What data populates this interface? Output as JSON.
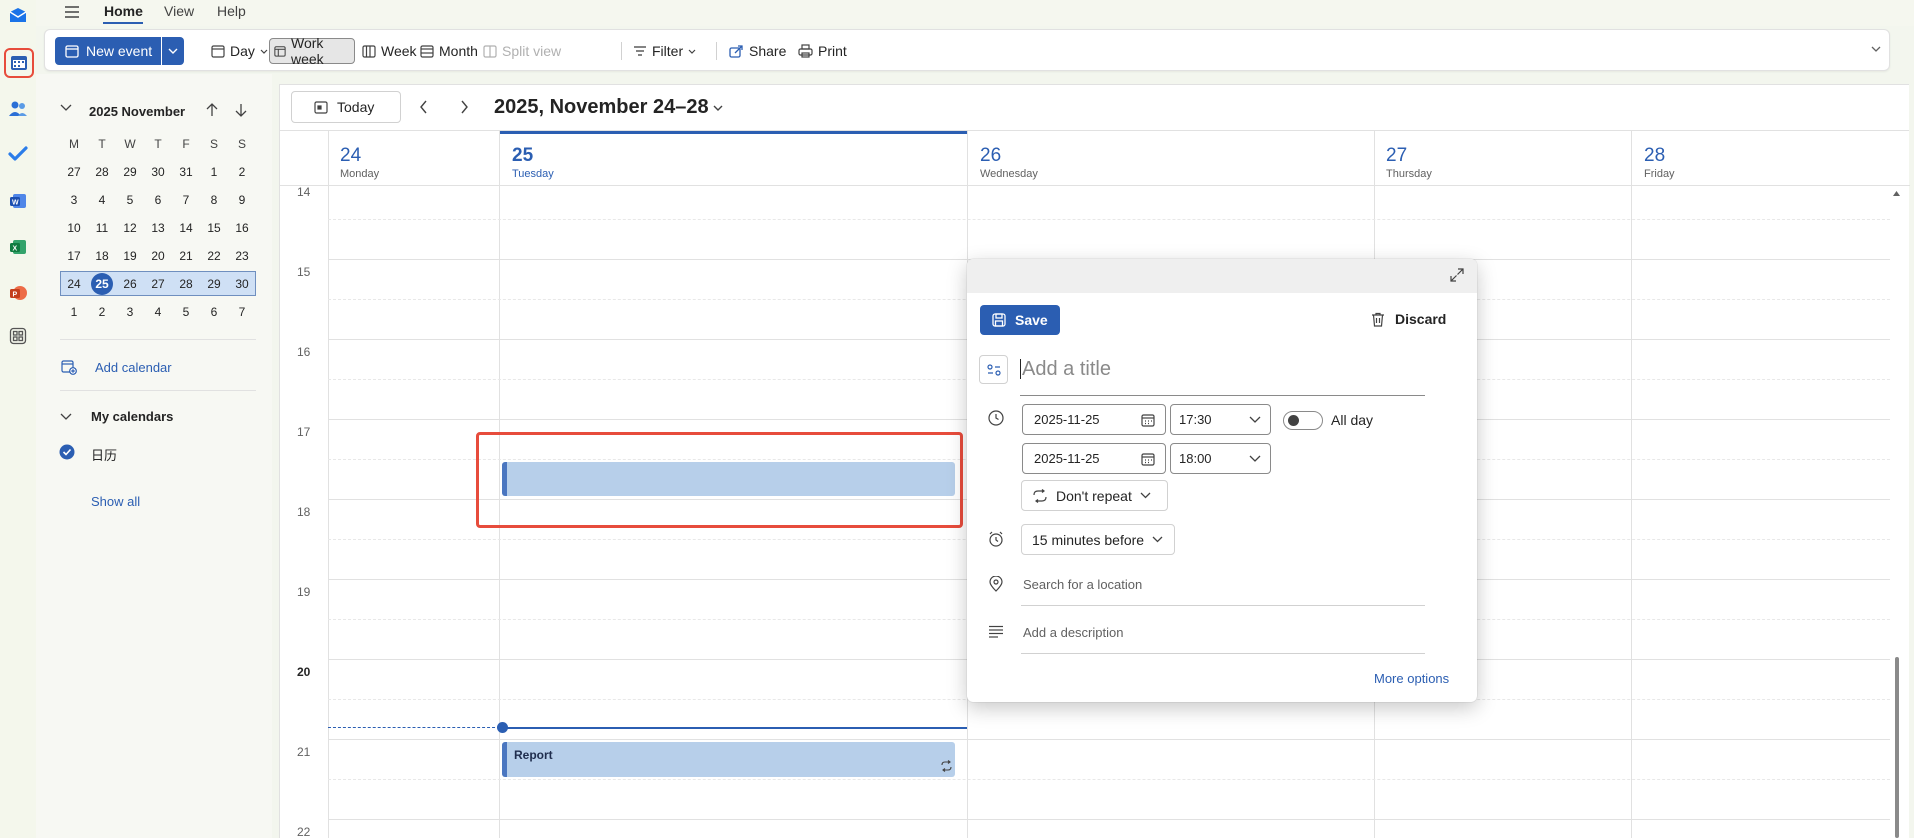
{
  "menubar": {
    "tabs": [
      "Home",
      "View",
      "Help"
    ]
  },
  "ribbon": {
    "new_event": "New event",
    "day": "Day",
    "work_week": "Work week",
    "week": "Week",
    "month": "Month",
    "split_view": "Split view",
    "filter": "Filter",
    "share": "Share",
    "print": "Print"
  },
  "mini_calendar": {
    "title": "2025 November",
    "weekday_headers": [
      "M",
      "T",
      "W",
      "T",
      "F",
      "S",
      "S"
    ],
    "weeks": [
      [
        "27",
        "28",
        "29",
        "30",
        "31",
        "1",
        "2"
      ],
      [
        "3",
        "4",
        "5",
        "6",
        "7",
        "8",
        "9"
      ],
      [
        "10",
        "11",
        "12",
        "13",
        "14",
        "15",
        "16"
      ],
      [
        "17",
        "18",
        "19",
        "20",
        "21",
        "22",
        "23"
      ],
      [
        "24",
        "25",
        "26",
        "27",
        "28",
        "29",
        "30"
      ],
      [
        "1",
        "2",
        "3",
        "4",
        "5",
        "6",
        "7"
      ]
    ],
    "today": "25"
  },
  "sidebar": {
    "add_calendar": "Add calendar",
    "my_calendars": "My calendars",
    "calendar_item": "日历",
    "show_all": "Show all"
  },
  "nav": {
    "today": "Today",
    "range_title": "2025, November 24–28"
  },
  "days": [
    {
      "num": "24",
      "name": "Monday"
    },
    {
      "num": "25",
      "name": "Tuesday"
    },
    {
      "num": "26",
      "name": "Wednesday"
    },
    {
      "num": "27",
      "name": "Thursday"
    },
    {
      "num": "28",
      "name": "Friday"
    }
  ],
  "hours": [
    "14",
    "15",
    "16",
    "17",
    "18",
    "19",
    "20",
    "21",
    "22"
  ],
  "events": [
    {
      "title": "Report",
      "recurring": true
    }
  ],
  "popup": {
    "save": "Save",
    "discard": "Discard",
    "title_placeholder": "Add a title",
    "start_date": "2025-11-25",
    "start_time": "17:30",
    "end_date": "2025-11-25",
    "end_time": "18:00",
    "all_day": "All day",
    "repeat": "Don't repeat",
    "reminder": "15 minutes before",
    "location_placeholder": "Search for a location",
    "description_placeholder": "Add a description",
    "more_options": "More options"
  },
  "colors": {
    "accent": "#2b5eb2",
    "event_fill": "#b7cfea",
    "highlight": "#e74c3c"
  }
}
